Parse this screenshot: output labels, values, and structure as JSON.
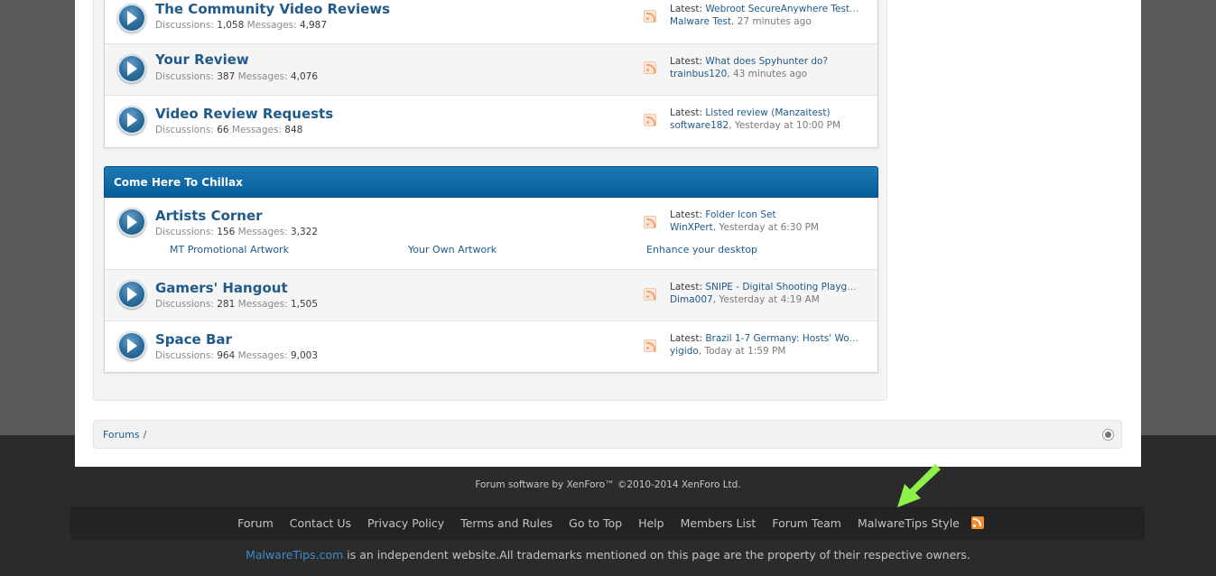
{
  "forums_top": [
    {
      "title": "The Community Video Reviews",
      "discussions_label": "Discussions:",
      "discussions": "1,058",
      "messages_label": "Messages:",
      "messages": "4,987",
      "latest_label": "Latest:",
      "latest_thread": "Webroot SecureAnywhere Test ...",
      "latest_user": "Malware Test",
      "latest_time": "27 minutes ago"
    },
    {
      "title": "Your Review",
      "discussions_label": "Discussions:",
      "discussions": "387",
      "messages_label": "Messages:",
      "messages": "4,076",
      "latest_label": "Latest:",
      "latest_thread": "What does Spyhunter do?",
      "latest_user": "trainbus120",
      "latest_time": "43 minutes ago"
    },
    {
      "title": "Video Review Requests",
      "discussions_label": "Discussions:",
      "discussions": "66",
      "messages_label": "Messages:",
      "messages": "848",
      "latest_label": "Latest:",
      "latest_thread": "Listed review (Manzaitest)",
      "latest_user": "software182",
      "latest_time": "Yesterday at 10:00 PM"
    }
  ],
  "category": {
    "title": "Come Here To Chillax",
    "forums": [
      {
        "title": "Artists Corner",
        "discussions_label": "Discussions:",
        "discussions": "156",
        "messages_label": "Messages:",
        "messages": "3,322",
        "latest_label": "Latest:",
        "latest_thread": "Folder Icon Set",
        "latest_user": "WinXPert",
        "latest_time": "Yesterday at 6:30 PM",
        "subforums": [
          "MT Promotional Artwork",
          "Your Own Artwork",
          "Enhance your desktop"
        ]
      },
      {
        "title": "Gamers' Hangout",
        "discussions_label": "Discussions:",
        "discussions": "281",
        "messages_label": "Messages:",
        "messages": "1,505",
        "latest_label": "Latest:",
        "latest_thread": "SNIPE - Digital Shooting Playgro...",
        "latest_user": "Dima007",
        "latest_time": "Yesterday at 4:19 AM"
      },
      {
        "title": "Space Bar",
        "discussions_label": "Discussions:",
        "discussions": "964",
        "messages_label": "Messages:",
        "messages": "9,003",
        "latest_label": "Latest:",
        "latest_thread": "Brazil 1-7 Germany: Hosts' Worl...",
        "latest_user": "yigido",
        "latest_time": "Today at 1:59 PM"
      }
    ]
  },
  "breadcrumb": {
    "item": "Forums",
    "separator": "/"
  },
  "footer": {
    "copyright": "Forum software by XenForo™ ©2010-2014 XenForo Ltd.",
    "links": [
      "Forum",
      "Contact Us",
      "Privacy Policy",
      "Terms and Rules",
      "Go to Top",
      "Help",
      "Members List",
      "Forum Team",
      "MalwareTips Style"
    ],
    "disclaimer_link": "MalwareTips.com",
    "disclaimer_text": " is an independent website.All trademarks mentioned on this page are the property of their respective owners."
  },
  "colors": {
    "category_header": "#065d99",
    "link": "#1f5a8a",
    "annotation_arrow": "#8ef04a"
  },
  "icons": [
    "forum-node-icon",
    "rss-icon",
    "jump-to-icon",
    "footer-rss-icon",
    "annotation-arrow-icon"
  ]
}
